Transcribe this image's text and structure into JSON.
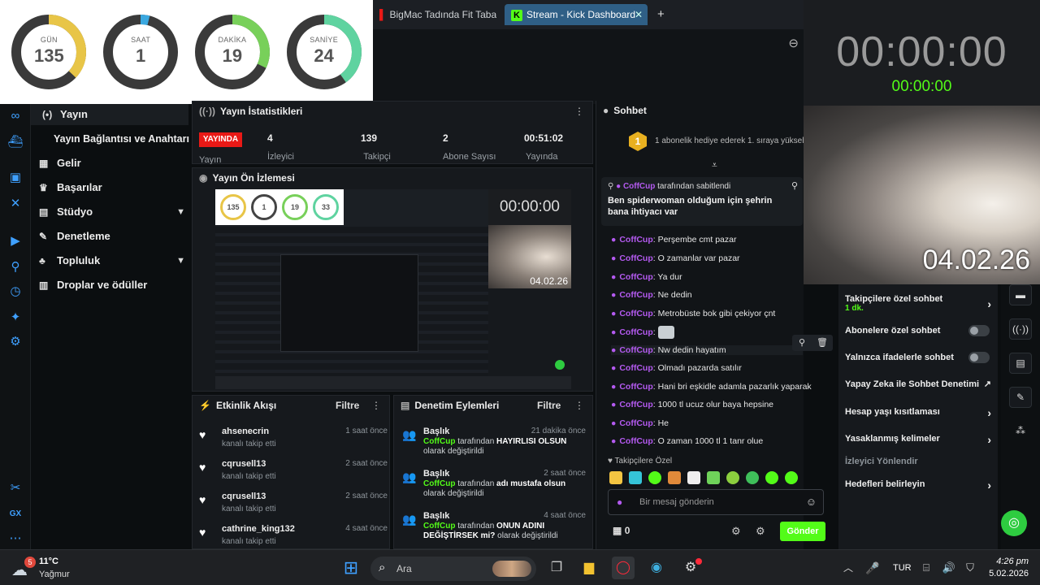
{
  "countdown": [
    {
      "label": "GÜN",
      "value": "135",
      "fraction": 0.37,
      "color": "#e8c547"
    },
    {
      "label": "SAAT",
      "value": "1",
      "fraction": 0.04,
      "color": "#3aa8e0"
    },
    {
      "label": "DAKİKA",
      "value": "19",
      "fraction": 0.32,
      "color": "#78d05a"
    },
    {
      "label": "SANİYE",
      "value": "24",
      "fraction": 0.4,
      "color": "#5fd3a0"
    }
  ],
  "tabs": [
    {
      "label": "BigMac Tadında Fit Tabak"
    },
    {
      "label": "Stream - Kick Dashboard",
      "icon": "K"
    }
  ],
  "timer": {
    "main": "00:00:00",
    "sub": "00:00:00"
  },
  "camera_date": "04.02.26",
  "sidebar": [
    {
      "label": "Yayın",
      "icon": "broadcast-icon"
    },
    {
      "label": "Yayın Bağlantısı ve Anahtarı",
      "icon": ""
    },
    {
      "label": "Gelir",
      "icon": "revenue-icon"
    },
    {
      "label": "Başarılar",
      "icon": "trophy-icon"
    },
    {
      "label": "Stüdyo",
      "icon": "studio-icon"
    },
    {
      "label": "Denetleme",
      "icon": "wrench-icon"
    },
    {
      "label": "Topluluk",
      "icon": "community-icon"
    },
    {
      "label": "Droplar ve ödüller",
      "icon": "drops-icon"
    }
  ],
  "stats": {
    "title": "Yayın İstatistikleri",
    "live_badge": "YAYINDA",
    "items": [
      {
        "value": "4",
        "label": "İzleyici"
      },
      {
        "value": "139",
        "label": "Takipçi"
      },
      {
        "value": "2",
        "label": "Abone Sayısı"
      },
      {
        "value": "00:51:02",
        "label": "Yayında"
      }
    ],
    "partial_label": "Yayın"
  },
  "preview": {
    "title": "Yayın Ön İzlemesi",
    "timer": "00:00:00",
    "date": "04.02.26",
    "rings": [
      "135",
      "1",
      "19",
      "33"
    ]
  },
  "activity": {
    "title": "Etkinlik Akışı",
    "filter": "Filtre",
    "rows": [
      {
        "name": "ahsenecrin",
        "sub": "kanalı takip etti",
        "time": "1 saat önce"
      },
      {
        "name": "cqrusell13",
        "sub": "kanalı takip etti",
        "time": "2 saat önce"
      },
      {
        "name": "cqrusell13",
        "sub": "kanalı takip etti",
        "time": "2 saat önce"
      },
      {
        "name": "cathrine_king132",
        "sub": "kanalı takip etti",
        "time": "4 saat önce"
      }
    ]
  },
  "moderation": {
    "title": "Denetim Eylemleri",
    "filter": "Filtre",
    "rows": [
      {
        "title": "Başlık",
        "user": "CoffCup",
        "mid": "tarafından",
        "value": "HAYIRLISI OLSUN",
        "tail": "olarak değiştirildi",
        "time": "21 dakika önce"
      },
      {
        "title": "Başlık",
        "user": "CoffCup",
        "mid": "tarafından",
        "value": "adı mustafa olsun",
        "tail": "olarak değiştirildi",
        "time": "2 saat önce"
      },
      {
        "title": "Başlık",
        "user": "CoffCup",
        "mid": "tarafından",
        "value": "ONUN ADINI DEĞİŞTİRSEK mi?",
        "tail": "olarak değiştirildi",
        "time": "4 saat önce"
      }
    ]
  },
  "chat": {
    "title": "Sohbet",
    "gift_banner": "1 abonelik hediye ederek 1. sıraya yükselin",
    "pinned_by": "CoffCup",
    "pinned_suffix": "tarafından sabitlendi",
    "pinned_text": "Ben spiderwoman olduğum için şehrin bana ihtiyacı var",
    "messages": [
      {
        "user": "CoffCup",
        "text": "Perşembe cmt pazar"
      },
      {
        "user": "CoffCup",
        "text": "O zamanlar var pazar"
      },
      {
        "user": "CoffCup",
        "text": "Ya dur"
      },
      {
        "user": "CoffCup",
        "text": "Ne dedin"
      },
      {
        "user": "CoffCup",
        "text": "Metrobüste bok gibi çekiyor çnt"
      },
      {
        "user": "CoffCup",
        "text": ""
      },
      {
        "user": "CoffCup",
        "text": "Nw dedin hayatım"
      },
      {
        "user": "CoffCup",
        "text": "Olmadı pazarda satılır"
      },
      {
        "user": "CoffCup",
        "text": "Hani bri eşkidle adamla pazarlık yaparak"
      },
      {
        "user": "CoffCup",
        "text": "1000 tl ucuz olur baya hepsine"
      },
      {
        "user": "CoffCup",
        "text": "He"
      },
      {
        "user": "CoffCup",
        "text": "O zaman 1000 tl 1 tanr olue"
      }
    ],
    "followers_only": "Takipçilere Özel",
    "input_placeholder": "Bir mesaj gönderin",
    "count": "0",
    "send": "Gönder"
  },
  "settings": [
    {
      "label": "Takipçilere özel sohbet",
      "sub": "1 dk.",
      "control": "chevron"
    },
    {
      "label": "Abonelere özel sohbet",
      "control": "toggle"
    },
    {
      "label": "Yalnızca ifadelerle sohbet",
      "control": "toggle"
    },
    {
      "label": "Yapay Zeka ile Sohbet Denetimi",
      "control": "external"
    },
    {
      "label": "Hesap yaşı kısıtlaması",
      "control": "chevron"
    },
    {
      "label": "Yasaklanmış kelimeler",
      "control": "chevron"
    },
    {
      "label": "İzleyici Yönlendir",
      "control": "none"
    },
    {
      "label": "Hedefleri belirleyin",
      "control": "chevron"
    }
  ],
  "taskbar": {
    "weather_temp": "11°C",
    "weather_desc": "Yağmur",
    "weather_badge": "5",
    "search": "Ara",
    "lang": "TUR",
    "time": "4:26 pm",
    "date": "5.02.2026"
  },
  "colors": {
    "kick_green": "#53fc18",
    "live_red": "#e91916",
    "chat_user": "#b45af0"
  }
}
